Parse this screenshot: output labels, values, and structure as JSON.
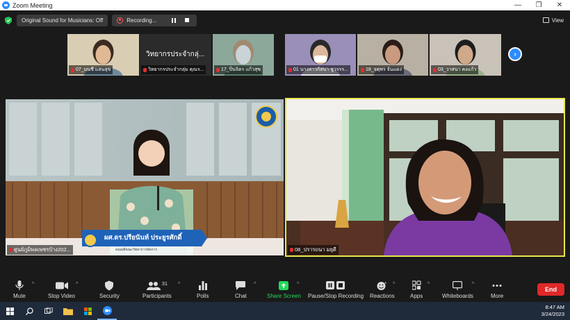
{
  "window": {
    "title": "Zoom Meeting"
  },
  "topbar": {
    "original_sound_label": "Original Sound for Musicians: Off",
    "recording_label": "Recording...",
    "view_label": "View"
  },
  "thumbnails": [
    {
      "name": "07_มนชี แสนสุข",
      "muted": true,
      "kind": "video"
    },
    {
      "name": "วิทยากรประจำกลุ่ม คุณร...",
      "muted": true,
      "kind": "text",
      "display_text": "วิทยากรประจำกลุ่...",
      "bg": "#2b2b2b"
    },
    {
      "name": "17_ปิ่นจิตร แก้วสุข",
      "muted": true,
      "kind": "video"
    },
    {
      "name": "01 นางสาวก้สนา ชูวรรร...",
      "muted": true,
      "kind": "video"
    },
    {
      "name": "18_จตุพร จันแดง",
      "muted": true,
      "kind": "video"
    },
    {
      "name": "03_วาสนา คงแก้ว",
      "muted": true,
      "kind": "video"
    }
  ],
  "main_tiles": [
    {
      "name": "ศูนย์ภูมิพลเพชรบ้าง202...",
      "muted": true,
      "banner_text": "ผศ.ดร.ปรียนันท์ ประยูรศักดิ์",
      "banner_sub": "คณบดีคณะวิทยาการจัดการ"
    },
    {
      "name": "08_ปรารถนา มยุดี",
      "muted": true,
      "active_speaker": true
    }
  ],
  "toolbar": {
    "mute_label": "Mute",
    "stop_video_label": "Stop Video",
    "security_label": "Security",
    "participants_label": "Participants",
    "participants_count": "31",
    "polls_label": "Polls",
    "chat_label": "Chat",
    "share_screen_label": "Share Screen",
    "pause_stop_recording_label": "Pause/Stop Recording",
    "reactions_label": "Reactions",
    "apps_label": "Apps",
    "whiteboards_label": "Whiteboards",
    "more_label": "More",
    "end_label": "End"
  },
  "taskbar": {
    "time": "8:47 AM",
    "date": "3/24/2023"
  },
  "colors": {
    "accent": "#2d8cff",
    "share_green": "#23d959",
    "end_red": "#e02828",
    "active_border": "#e6e64a"
  }
}
